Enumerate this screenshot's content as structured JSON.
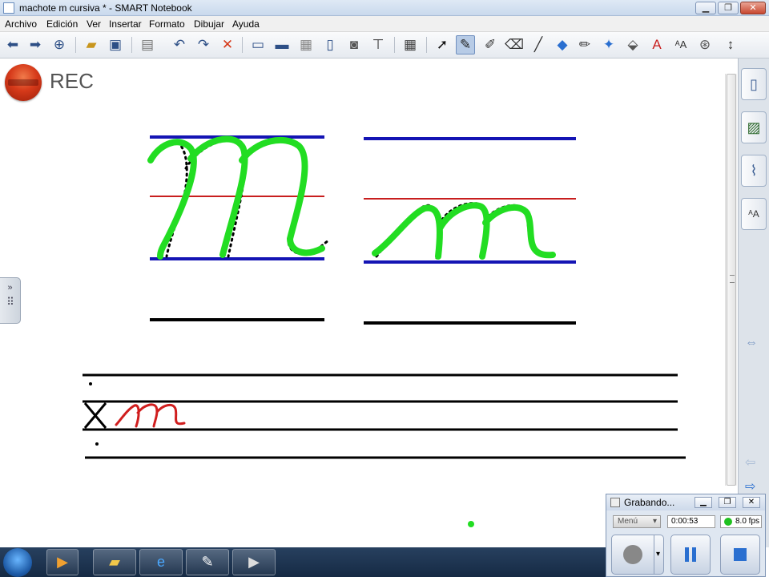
{
  "window": {
    "title": "machote m cursiva * - SMART Notebook",
    "minimize": "▁",
    "maximize": "❐",
    "close": "✕"
  },
  "menu": [
    "Archivo",
    "Edición",
    "Ver",
    "Insertar",
    "Formato",
    "Dibujar",
    "Ayuda"
  ],
  "toolbar_icons": [
    "back-icon",
    "forward-icon",
    "add-page-icon",
    "open-icon",
    "save-icon",
    "paste-icon",
    "undo-icon",
    "redo-icon",
    "delete-icon",
    "screen-shade-icon",
    "display-icon",
    "capture-icon",
    "dual-page-icon",
    "camera-icon",
    "pen-tool-icon",
    "table-icon",
    "select-icon",
    "pen-icon",
    "creative-pen-icon",
    "eraser-icon",
    "line-icon",
    "shape-icon",
    "magic-pen-icon",
    "fill-icon",
    "text-icon",
    "properties-icon",
    "move-toolbar-icon"
  ],
  "canvas": {
    "rec_label": "REC",
    "guide_colors": {
      "blue": "#1414b4",
      "red": "#c81e1e",
      "black": "#000000",
      "trace": "#22dd22"
    }
  },
  "recorder": {
    "title": "Grabando...",
    "menu_label": "Menú",
    "elapsed": "0:00:53",
    "fps": "8.0 fps"
  }
}
